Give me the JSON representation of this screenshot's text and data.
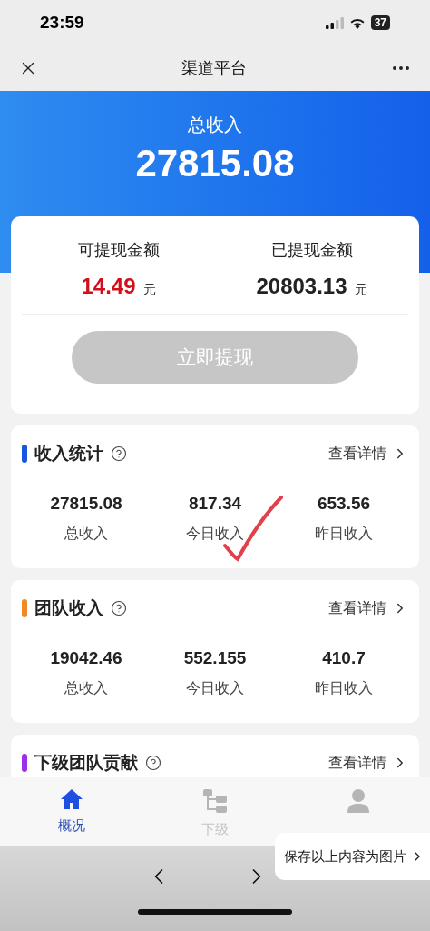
{
  "status_bar": {
    "time": "23:59",
    "battery": "37"
  },
  "nav": {
    "title": "渠道平台"
  },
  "header": {
    "label": "总收入",
    "amount": "27815.08"
  },
  "balance": {
    "items": [
      {
        "label": "可提现金额",
        "value": "14.49",
        "unit": "元",
        "kind": "highlight"
      },
      {
        "label": "已提现金额",
        "value": "20803.13",
        "unit": "元",
        "kind": "normal"
      }
    ],
    "button": {
      "label": "立即提现",
      "disabled": true
    }
  },
  "sections": [
    {
      "title": "收入统计",
      "color": "#1a56db",
      "link": "查看详情",
      "stats": [
        {
          "value": "27815.08",
          "label": "总收入"
        },
        {
          "value": "817.34",
          "label": "今日收入"
        },
        {
          "value": "653.56",
          "label": "昨日收入"
        }
      ]
    },
    {
      "title": "团队收入",
      "color": "#f08a24",
      "link": "查看详情",
      "stats": [
        {
          "value": "19042.46",
          "label": "总收入"
        },
        {
          "value": "552.155",
          "label": "今日收入"
        },
        {
          "value": "410.7",
          "label": "昨日收入"
        }
      ]
    },
    {
      "title": "下级团队贡献",
      "color": "#9b30e8",
      "link": "查看详情"
    }
  ],
  "tabs": [
    {
      "kind": "home",
      "label": "概况",
      "selected": true
    },
    {
      "kind": "tree",
      "label": "下级",
      "selected": false
    },
    {
      "kind": "person",
      "selected": false
    }
  ],
  "popup": {
    "label": "保存以上内容为图片"
  }
}
